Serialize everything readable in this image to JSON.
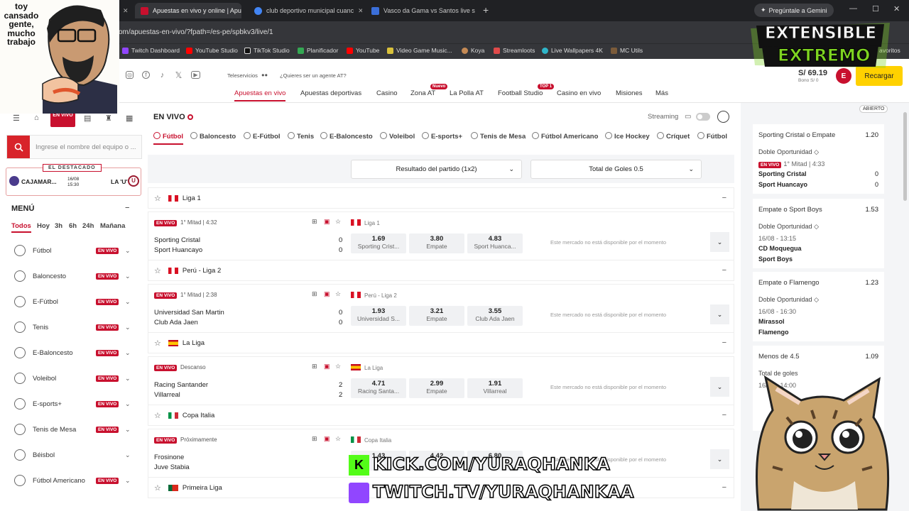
{
  "browser": {
    "tabs": [
      {
        "title": "Apuestas en vivo y online | Apu",
        "active": true
      },
      {
        "title": "club deportivo municipal cuanc",
        "active": false
      },
      {
        "title": "Vasco da Gama vs Santos live s",
        "active": false
      }
    ],
    "gemini_label": "Pregúntale a Gemini",
    "url": "om/apuestas-en-vivo/?fpath=/es-pe/spbkv3/live/1",
    "bookmarks": [
      "Twitch Dashboard",
      "YouTube Studio",
      "TikTok Studio",
      "Planificador",
      "YouTube",
      "Video Game Music...",
      "Koya",
      "Streamloots",
      "Live Wallpapers 4K",
      "MC Utils"
    ],
    "bookmarks_more": "avoritos"
  },
  "overlay": {
    "streamer_caption": "toy cansado gente, mucho trabajo",
    "logo_line1": "EXTENSIBLE",
    "logo_line2": "EXTREMO",
    "kick": "KICK.COM/YURAQHANKA",
    "twitch": "TWITCH.TV/YURAQHANKAA"
  },
  "header": {
    "teleservicios": "Teleservicios",
    "agent": "¿Quieres ser un agente AT?",
    "nav": [
      {
        "label": "Apuestas en vivo",
        "badge": ""
      },
      {
        "label": "Apuestas deportivas",
        "badge": ""
      },
      {
        "label": "Casino",
        "badge": ""
      },
      {
        "label": "Zona AT",
        "badge": "Nuevo"
      },
      {
        "label": "La Polla AT",
        "badge": ""
      },
      {
        "label": "Football Studio",
        "badge": "TOP 1"
      },
      {
        "label": "Casino en vivo",
        "badge": ""
      },
      {
        "label": "Misiones",
        "badge": ""
      },
      {
        "label": "Más",
        "badge": ""
      }
    ],
    "balance": "S/ 69.19",
    "balance_sub": "Bono S/ 0",
    "recargar": "Recargar"
  },
  "sidebar": {
    "envivo_tab": "EN VIVO",
    "search_placeholder": "Ingrese el nombre del equipo o ...",
    "destacado_label": "EL DESTACADO",
    "destacado_home": "CAJAMAR...",
    "destacado_date": "16/08",
    "destacado_time": "15:30",
    "destacado_away": "LA 'U'",
    "menu_title": "MENÚ",
    "filters": [
      "Todos",
      "Hoy",
      "3h",
      "6h",
      "24h",
      "Mañana"
    ],
    "live_label": "EN VIVO",
    "sports": [
      {
        "label": "Fútbol",
        "live": true
      },
      {
        "label": "Baloncesto",
        "live": true
      },
      {
        "label": "E-Fútbol",
        "live": true
      },
      {
        "label": "Tenis",
        "live": true
      },
      {
        "label": "E-Baloncesto",
        "live": true
      },
      {
        "label": "Voleibol",
        "live": true
      },
      {
        "label": "E-sports+",
        "live": true
      },
      {
        "label": "Tenis de Mesa",
        "live": true
      },
      {
        "label": "Béisbol",
        "live": false
      },
      {
        "label": "Fútbol Americano",
        "live": true
      }
    ]
  },
  "main": {
    "title": "EN VIVO",
    "streaming": "Streaming",
    "sport_tabs": [
      "Fútbol",
      "Baloncesto",
      "E-Fútbol",
      "Tenis",
      "E-Baloncesto",
      "Voleibol",
      "E-sports+",
      "Tenis de Mesa",
      "Fútbol Americano",
      "Ice Hockey",
      "Críquet",
      "Fútbol"
    ],
    "market_select": "Resultado del partido (1x2)",
    "goals_select": "Total de Goles 0.5",
    "no_market": "Este mercado no está disponible por el momento",
    "live_label": "EN VIVO",
    "leagues": [
      {
        "name": "Liga 1",
        "flag": "pe",
        "match": {
          "status": "1° Mitad | 4:32",
          "league": "Liga 1",
          "home": "Sporting Cristal",
          "away": "Sport Huancayo",
          "hs": "0",
          "as": "0",
          "odds": [
            {
              "v": "1.69",
              "l": "Sporting Crist..."
            },
            {
              "v": "3.80",
              "l": "Empate"
            },
            {
              "v": "4.83",
              "l": "Sport Huanca..."
            }
          ],
          "live": true
        }
      },
      {
        "name": "Perú - Liga 2",
        "flag": "pe",
        "match": {
          "status": "1° Mitad | 2:38",
          "league": "Perú - Liga 2",
          "home": "Universidad San Martin",
          "away": "Club Ada Jaen",
          "hs": "0",
          "as": "0",
          "odds": [
            {
              "v": "1.93",
              "l": "Universidad S..."
            },
            {
              "v": "3.21",
              "l": "Empate"
            },
            {
              "v": "3.55",
              "l": "Club Ada Jaen"
            }
          ],
          "live": true
        }
      },
      {
        "name": "La Liga",
        "flag": "es",
        "match": {
          "status": "Descanso",
          "league": "La Liga",
          "home": "Racing Santander",
          "away": "Villarreal",
          "hs": "2",
          "as": "2",
          "odds": [
            {
              "v": "4.71",
              "l": "Racing Santa..."
            },
            {
              "v": "2.99",
              "l": "Empate"
            },
            {
              "v": "1.91",
              "l": "Villarreal"
            }
          ],
          "live": true
        }
      },
      {
        "name": "Copa Italia",
        "flag": "it",
        "match": {
          "status": "Próximamente",
          "league": "Copa Italia",
          "home": "Frosinone",
          "away": "Juve Stabia",
          "hs": "",
          "as": "",
          "odds": [
            {
              "v": "1.43",
              "l": ""
            },
            {
              "v": "4.42",
              "l": ""
            },
            {
              "v": "6.80",
              "l": ""
            }
          ],
          "live": true
        }
      },
      {
        "name": "Primeira Liga",
        "flag": "pt",
        "match": null
      }
    ]
  },
  "betslip": {
    "header_state": "ABIERTO",
    "items": [
      {
        "title": "Sporting Cristal o Empate",
        "odds": "1.20",
        "type": "Doble Oportunidad",
        "meta": "1° Mitad | 4:33",
        "live": true,
        "t1": "Sporting Cristal",
        "s1": "0",
        "t2": "Sport Huancayo",
        "s2": "0"
      },
      {
        "title": "Empate o Sport Boys",
        "odds": "1.53",
        "type": "Doble Oportunidad",
        "meta": "16/08 - 13:15",
        "live": false,
        "t1": "CD Moquegua",
        "s1": "",
        "t2": "Sport Boys",
        "s2": ""
      },
      {
        "title": "Empate o Flamengo",
        "odds": "1.23",
        "type": "Doble Oportunidad",
        "meta": "16/08 - 16:30",
        "live": false,
        "t1": "Mirassol",
        "s1": "",
        "t2": "Flamengo",
        "s2": ""
      },
      {
        "title": "Menos de 4.5",
        "odds": "1.09",
        "type": "Total de goles",
        "meta": "16/08 - 14:00",
        "live": false,
        "t1": "",
        "s1": "",
        "t2": "",
        "s2": ""
      }
    ]
  },
  "colors": {
    "brand_red": "#c8102e",
    "recargar_yellow": "#ffd100"
  }
}
